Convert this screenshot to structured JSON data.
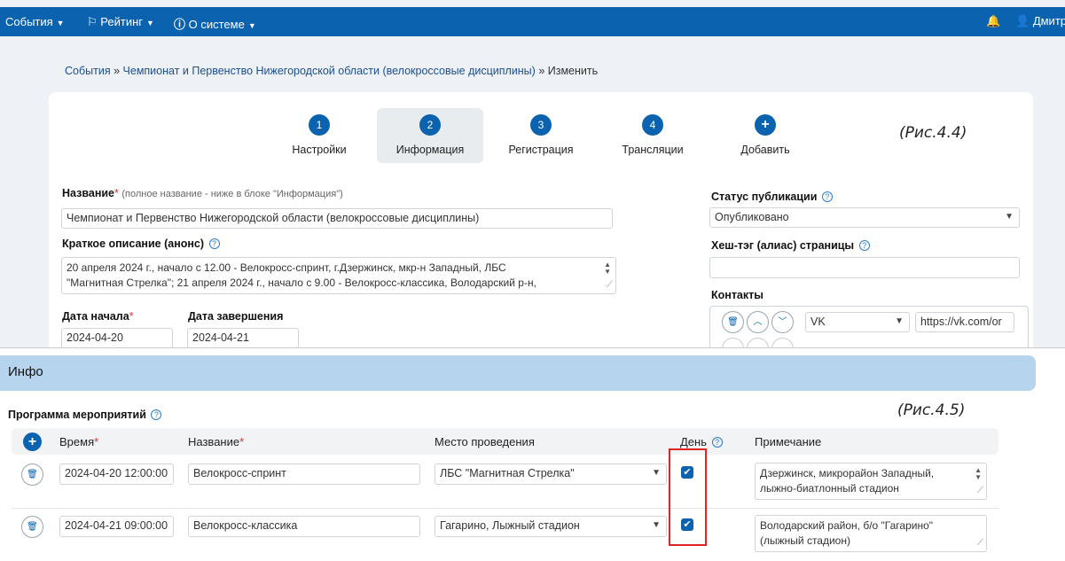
{
  "nav": {
    "items": [
      "События",
      "Рейтинг",
      "О системе"
    ],
    "user": "Дмитр"
  },
  "breadcrumb": {
    "link1": "События",
    "link2": "Чемпионат и Первенство Нижегородской области (велокроссовые дисциплины)",
    "separator": "»",
    "current": "Изменить"
  },
  "wizard": {
    "steps": [
      {
        "number": "1",
        "label": "Настройки"
      },
      {
        "number": "2",
        "label": "Информация"
      },
      {
        "number": "3",
        "label": "Регистрация"
      },
      {
        "number": "4",
        "label": "Трансляции"
      },
      {
        "number": "+",
        "label": "Добавить"
      }
    ],
    "active_step": 2
  },
  "captions": {
    "fig44": "(Рис.4.4)",
    "fig45": "(Рис.4.5)"
  },
  "form": {
    "name_label": "Название",
    "name_hint": "(полное название - ниже в блоке \"Информация\")",
    "name_value": "Чемпионат и Первенство Нижегородской области (велокроссовые дисциплины)",
    "short_label": "Краткое описание (анонс)",
    "short_line1": "20 апреля 2024 г., начало с 12.00 - Велокросс-спринт, г.Дзержинск, мкр-н Западный, ЛБС",
    "short_line2": "\"Магнитная Стрелка\"; 21 апреля 2024 г., начало с 9.00 - Велокросс-классика, Володарский р-н,",
    "start_label": "Дата начала",
    "start_value": "2024-04-20",
    "end_label": "Дата завершения",
    "end_value": "2024-04-21",
    "status_label": "Статус публикации",
    "status_value": "Опубликовано",
    "alias_label": "Хеш-тэг (алиас) страницы",
    "alias_value": "",
    "contacts_label": "Контакты",
    "contact_type": "VK",
    "contact_url": "https://vk.com/or"
  },
  "info": {
    "header": "Инфо",
    "program_title": "Программа мероприятий",
    "columns": {
      "time": "Время",
      "name": "Название",
      "place": "Место проведения",
      "day": "День",
      "note": "Примечание"
    },
    "rows": [
      {
        "time": "2024-04-20 12:00:00",
        "name": "Велокросс-спринт",
        "place": "ЛБС \"Магнитная Стрелка\"",
        "day_checked": true,
        "note_line1": "Дзержинск, микрорайон Западный,",
        "note_line2": "лыжно-биатлонный стадион"
      },
      {
        "time": "2024-04-21 09:00:00",
        "name": "Велокросс-классика",
        "place": "Гагарино, Лыжный стадион",
        "day_checked": true,
        "note_line1": "Володарский район, б/о \"Гагарино\"",
        "note_line2": "(лыжный стадион)"
      }
    ]
  },
  "colors": {
    "accent": "#0b63b0",
    "highlight": "#e02424",
    "info_header": "#b7d4ef"
  }
}
